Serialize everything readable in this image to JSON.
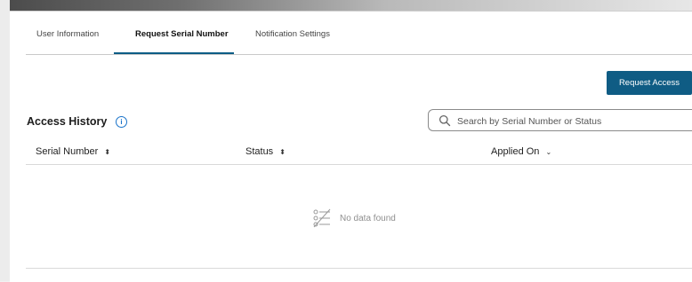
{
  "tabs": [
    {
      "label": "User Information",
      "active": false
    },
    {
      "label": "Request Serial Number",
      "active": true
    },
    {
      "label": "Notification Settings",
      "active": false
    }
  ],
  "actions": {
    "request_access_label": "Request Access"
  },
  "access_history": {
    "title": "Access History",
    "info_icon": "info-icon",
    "search": {
      "placeholder": "Search by Serial Number or Status",
      "value": ""
    },
    "columns": [
      {
        "label": "Serial Number",
        "sort_icon": "sort-both-icon"
      },
      {
        "label": "Status",
        "sort_icon": "sort-both-icon"
      },
      {
        "label": "Applied On",
        "sort_icon": "sort-down-icon"
      }
    ],
    "rows": [],
    "empty": {
      "message": "No data found",
      "icon": "no-data-icon"
    }
  },
  "colors": {
    "accent": "#0f5c84",
    "info": "#1a73c9"
  }
}
